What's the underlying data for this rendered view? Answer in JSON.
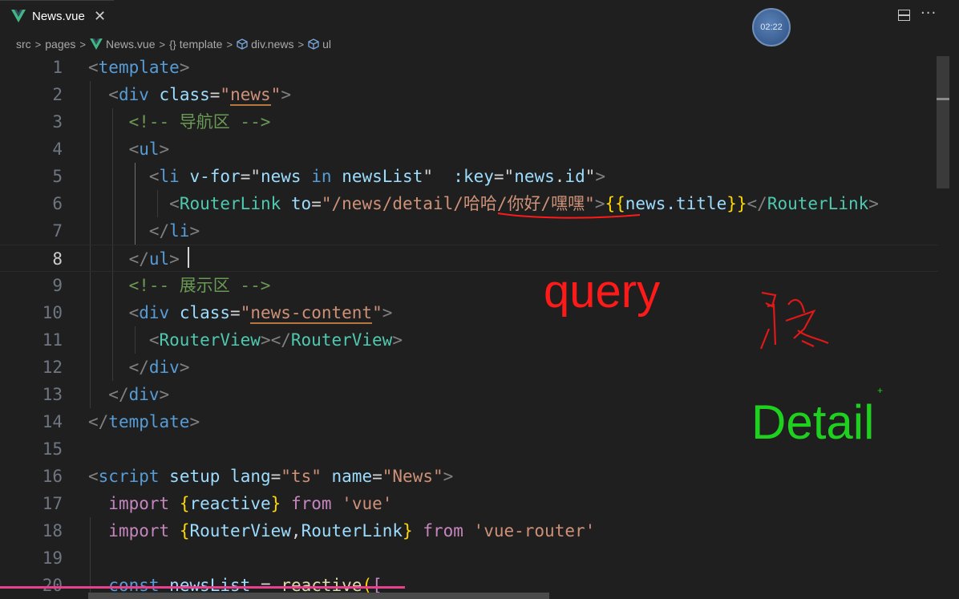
{
  "tab": {
    "label": "News.vue",
    "close": "✕"
  },
  "timer": {
    "label": "02:22"
  },
  "breadcrumb": {
    "items": [
      "src",
      "pages",
      "News.vue",
      "template",
      "div.news",
      "ul"
    ]
  },
  "editor": {
    "active_line": 8,
    "lines": [
      {
        "n": "1"
      },
      {
        "n": "2"
      },
      {
        "n": "3"
      },
      {
        "n": "4"
      },
      {
        "n": "5"
      },
      {
        "n": "6"
      },
      {
        "n": "7"
      },
      {
        "n": "8"
      },
      {
        "n": "9"
      },
      {
        "n": "10"
      },
      {
        "n": "11"
      },
      {
        "n": "12"
      },
      {
        "n": "13"
      },
      {
        "n": "14"
      },
      {
        "n": "15"
      },
      {
        "n": "16"
      },
      {
        "n": "17"
      },
      {
        "n": "18"
      },
      {
        "n": "19"
      },
      {
        "n": "20"
      }
    ],
    "tokens": {
      "l3_comment": "<!-- 导航区 -->",
      "l9_comment": "<!-- 展示区 -->",
      "l6_path": "/news/detail/哈哈/你好/嘿嘿",
      "l6_title": "news.title",
      "l16_name": "News",
      "l18_pkg": "'vue-router'",
      "l17_pkg": "'vue'"
    }
  },
  "annotations": {
    "query": "query",
    "detail": "Detail",
    "plus": "+"
  },
  "colors": {
    "background": "#1f1f1f",
    "tag": "#569cd6",
    "attribute": "#9cdcfe",
    "string": "#ce9178",
    "comment": "#6a9955",
    "keyword": "#c586c0",
    "component": "#4ec9b0",
    "annotation_red": "#ff1a1a",
    "annotation_green": "#1fd11f"
  },
  "icons": {
    "tab": "vue-logo-icon",
    "split": "split-editor-icon",
    "more": "more-actions-icon"
  }
}
